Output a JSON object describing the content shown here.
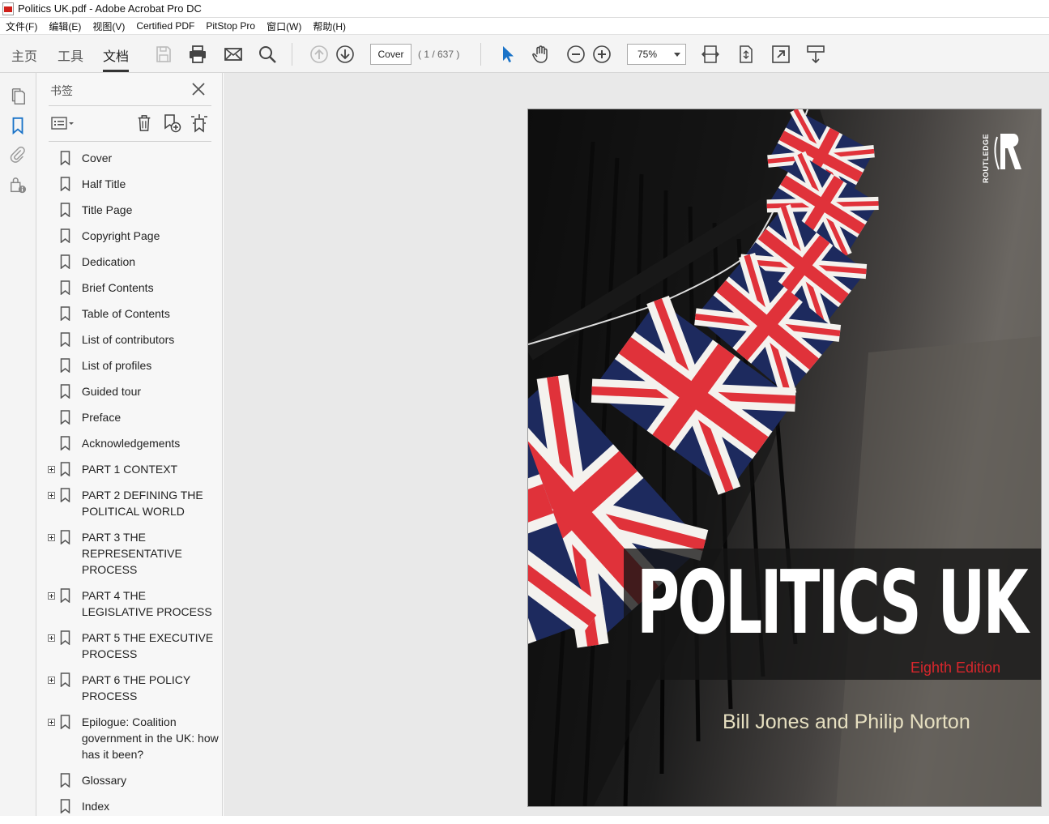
{
  "window": {
    "title": "Politics UK.pdf - Adobe Acrobat Pro DC"
  },
  "menu": [
    "文件(F)",
    "编辑(E)",
    "视图(V)",
    "Certified PDF",
    "PitStop Pro",
    "窗口(W)",
    "帮助(H)"
  ],
  "toolbar": {
    "tabs": [
      "主页",
      "工具",
      "文档"
    ],
    "active_tab": "文档",
    "page_field": "Cover",
    "page_count": "( 1 / 637 )",
    "zoom": "75%"
  },
  "bookmarks": {
    "title": "书签",
    "items": [
      {
        "label": "Cover",
        "expandable": false
      },
      {
        "label": "Half Title",
        "expandable": false
      },
      {
        "label": "Title Page",
        "expandable": false
      },
      {
        "label": "Copyright Page",
        "expandable": false
      },
      {
        "label": "Dedication",
        "expandable": false
      },
      {
        "label": "Brief Contents",
        "expandable": false
      },
      {
        "label": "Table of Contents",
        "expandable": false
      },
      {
        "label": "List of contributors",
        "expandable": false
      },
      {
        "label": "List of profiles",
        "expandable": false
      },
      {
        "label": "Guided tour",
        "expandable": false
      },
      {
        "label": "Preface",
        "expandable": false
      },
      {
        "label": "Acknowledgements",
        "expandable": false
      },
      {
        "label": "PART 1 CONTEXT",
        "expandable": true
      },
      {
        "label": "PART 2 DEFINING THE POLITICAL WORLD",
        "expandable": true
      },
      {
        "label": "PART 3 THE REPRESENTATIVE PROCESS",
        "expandable": true
      },
      {
        "label": "PART 4 THE LEGISLATIVE PROCESS",
        "expandable": true
      },
      {
        "label": "PART 5 THE EXECUTIVE PROCESS",
        "expandable": true
      },
      {
        "label": "PART 6 THE POLICY PROCESS",
        "expandable": true
      },
      {
        "label": "Epilogue: Coalition government in the UK: how has it been?",
        "expandable": true
      },
      {
        "label": "Glossary",
        "expandable": false
      },
      {
        "label": "Index",
        "expandable": false
      }
    ]
  },
  "cover": {
    "title": "POLITICS UK",
    "edition": "Eighth Edition",
    "authors": "Bill Jones and Philip Norton",
    "publisher": "ROUTLEDGE"
  },
  "colors": {
    "accent_blue": "#1a73c8",
    "edition_red": "#d8262c",
    "flag_blue": "#1d2a5e",
    "flag_red": "#e0323a"
  }
}
